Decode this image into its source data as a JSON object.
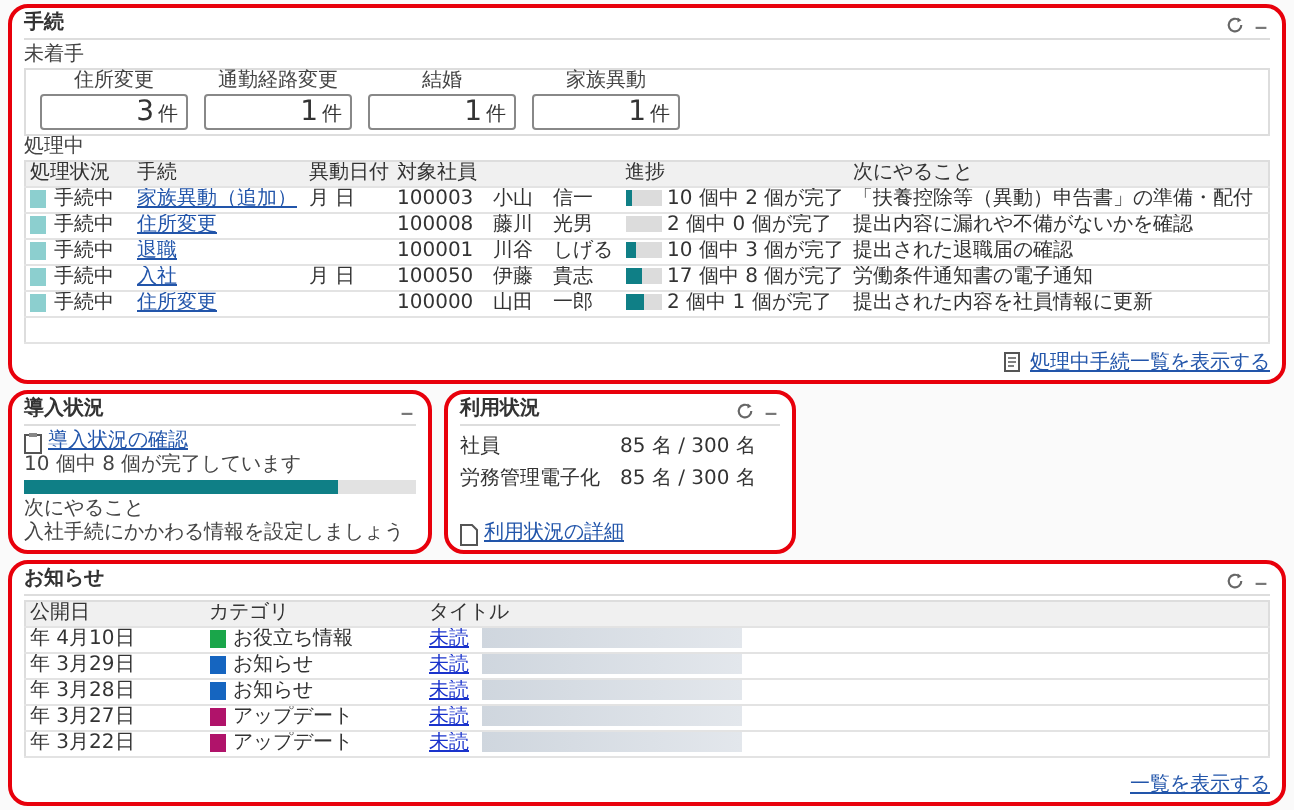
{
  "procedures": {
    "title": "手続",
    "refresh": true,
    "not_started": {
      "label": "未着手",
      "items": [
        {
          "label": "住所変更",
          "count": "3",
          "unit": "件"
        },
        {
          "label": "通勤経路変更",
          "count": "1",
          "unit": "件"
        },
        {
          "label": "結婚",
          "count": "1",
          "unit": "件"
        },
        {
          "label": "家族異動",
          "count": "1",
          "unit": "件"
        }
      ]
    },
    "in_progress": {
      "label": "処理中",
      "columns": [
        "処理状況",
        "手続",
        "異動日付",
        "対象社員",
        "進捗",
        "次にやること"
      ],
      "rows": [
        {
          "status": "手続中",
          "procedure": "家族異動（追加）",
          "date": "月 日",
          "employee_id": "100003",
          "employee_name": "小山　信一",
          "progress": "10 個中 2 個が完了",
          "level": 0.2,
          "next": "「扶養控除等（異動）申告書」の準備・配付"
        },
        {
          "status": "手続中",
          "procedure": "住所変更",
          "employee_id": "100008",
          "employee_name": "藤川　光男",
          "progress": "2 個中 0 個が完了",
          "level": 0,
          "next": "提出内容に漏れや不備がないかを確認"
        },
        {
          "status": "手続中",
          "procedure": "退職",
          "employee_id": "100001",
          "employee_name": "川谷　しげる",
          "progress": "10 個中 3 個が完了",
          "level": 0.3,
          "next": "提出された退職届の確認"
        },
        {
          "status": "手続中",
          "procedure": "入社",
          "date": "月 日",
          "employee_id": "100050",
          "employee_name": "伊藤　貴志",
          "progress": "17 個中 8 個が完了",
          "level": 0.47,
          "next": "労働条件通知書の電子通知"
        },
        {
          "status": "手続中",
          "procedure": "住所変更",
          "employee_id": "100000",
          "employee_name": "山田　一郎",
          "progress": "2 個中 1 個が完了",
          "level": 0.5,
          "next": "提出された内容を社員情報に更新"
        }
      ]
    },
    "link": "処理中手続一覧を表示する"
  },
  "introduction": {
    "title": "導入状況",
    "refresh": false,
    "link": "導入状況の確認",
    "progress": "10 個中 8 個が完了しています",
    "level": 0.8,
    "next_label": "次にやること",
    "next": "入社手続にかかわる情報を設定しましょう"
  },
  "usage": {
    "title": "利用状況",
    "refresh": true,
    "rows": [
      {
        "label": "社員",
        "count": "85 名 / 300 名"
      },
      {
        "label": "労務管理電子化",
        "count": "85 名 / 300 名"
      }
    ],
    "link": "利用状況の詳細"
  },
  "notices": {
    "title": "お知らせ",
    "refresh": true,
    "columns": [
      "公開日",
      "カテゴリ",
      "タイトル"
    ],
    "rows": [
      {
        "date": "年 4月10日",
        "category": "お役立ち情報",
        "color": "#1aa64a",
        "title": "未読"
      },
      {
        "date": "年 3月29日",
        "category": "お知らせ",
        "color": "#1565c0",
        "title": "未読"
      },
      {
        "date": "年 3月28日",
        "category": "お知らせ",
        "color": "#1565c0",
        "title": "未読"
      },
      {
        "date": "年 3月27日",
        "category": "アップデート",
        "color": "#b0136a",
        "title": "未読"
      },
      {
        "date": "年 3月22日",
        "category": "アップデート",
        "color": "#b0136a",
        "title": "未読"
      }
    ],
    "link": "一覧を表示する"
  }
}
